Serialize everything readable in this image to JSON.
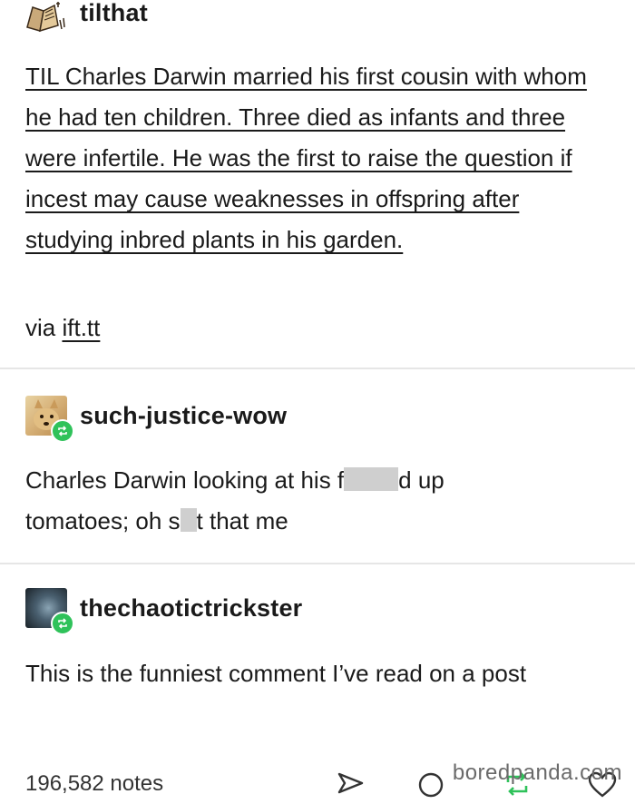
{
  "post": {
    "author": "tilthat",
    "body": "TIL Charles Darwin married his first cousin with whom he had ten children. Three died as infants and three were infertile. He was the first to raise the question if incest may cause weaknesses in offspring after studying inbred plants in his garden.",
    "via_prefix": "via ",
    "via_link": "ift.tt"
  },
  "reblog1": {
    "author": "such-justice-wow",
    "line1_a": "Charles Darwin looking at his f",
    "line1_b": "d up",
    "line2_a": "tomatoes; oh s",
    "line2_b": "t that me"
  },
  "reblog2": {
    "author": "thechaotictrickster",
    "body": "This is the funniest comment I’ve read on a post"
  },
  "footer": {
    "notes": "196,582 notes"
  },
  "watermark": "boredpanda.com",
  "colors": {
    "reblog_badge": "#2fc25a",
    "divider": "#e6e6e6"
  }
}
